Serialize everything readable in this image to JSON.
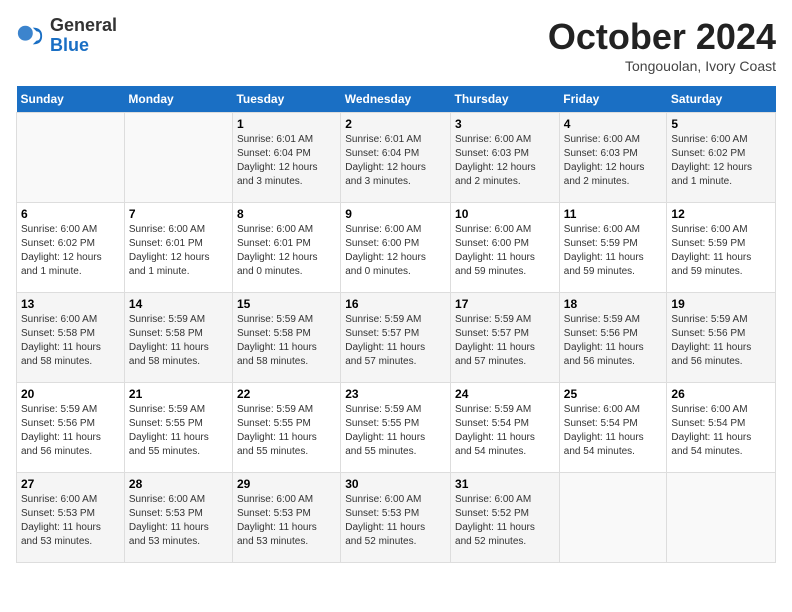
{
  "header": {
    "logo": {
      "general": "General",
      "blue": "Blue"
    },
    "title": "October 2024",
    "location": "Tongouolan, Ivory Coast"
  },
  "calendar": {
    "days_of_week": [
      "Sunday",
      "Monday",
      "Tuesday",
      "Wednesday",
      "Thursday",
      "Friday",
      "Saturday"
    ],
    "weeks": [
      [
        {
          "day": "",
          "info": ""
        },
        {
          "day": "",
          "info": ""
        },
        {
          "day": "1",
          "info": "Sunrise: 6:01 AM\nSunset: 6:04 PM\nDaylight: 12 hours\nand 3 minutes."
        },
        {
          "day": "2",
          "info": "Sunrise: 6:01 AM\nSunset: 6:04 PM\nDaylight: 12 hours\nand 3 minutes."
        },
        {
          "day": "3",
          "info": "Sunrise: 6:00 AM\nSunset: 6:03 PM\nDaylight: 12 hours\nand 2 minutes."
        },
        {
          "day": "4",
          "info": "Sunrise: 6:00 AM\nSunset: 6:03 PM\nDaylight: 12 hours\nand 2 minutes."
        },
        {
          "day": "5",
          "info": "Sunrise: 6:00 AM\nSunset: 6:02 PM\nDaylight: 12 hours\nand 1 minute."
        }
      ],
      [
        {
          "day": "6",
          "info": "Sunrise: 6:00 AM\nSunset: 6:02 PM\nDaylight: 12 hours\nand 1 minute."
        },
        {
          "day": "7",
          "info": "Sunrise: 6:00 AM\nSunset: 6:01 PM\nDaylight: 12 hours\nand 1 minute."
        },
        {
          "day": "8",
          "info": "Sunrise: 6:00 AM\nSunset: 6:01 PM\nDaylight: 12 hours\nand 0 minutes."
        },
        {
          "day": "9",
          "info": "Sunrise: 6:00 AM\nSunset: 6:00 PM\nDaylight: 12 hours\nand 0 minutes."
        },
        {
          "day": "10",
          "info": "Sunrise: 6:00 AM\nSunset: 6:00 PM\nDaylight: 11 hours\nand 59 minutes."
        },
        {
          "day": "11",
          "info": "Sunrise: 6:00 AM\nSunset: 5:59 PM\nDaylight: 11 hours\nand 59 minutes."
        },
        {
          "day": "12",
          "info": "Sunrise: 6:00 AM\nSunset: 5:59 PM\nDaylight: 11 hours\nand 59 minutes."
        }
      ],
      [
        {
          "day": "13",
          "info": "Sunrise: 6:00 AM\nSunset: 5:58 PM\nDaylight: 11 hours\nand 58 minutes."
        },
        {
          "day": "14",
          "info": "Sunrise: 5:59 AM\nSunset: 5:58 PM\nDaylight: 11 hours\nand 58 minutes."
        },
        {
          "day": "15",
          "info": "Sunrise: 5:59 AM\nSunset: 5:58 PM\nDaylight: 11 hours\nand 58 minutes."
        },
        {
          "day": "16",
          "info": "Sunrise: 5:59 AM\nSunset: 5:57 PM\nDaylight: 11 hours\nand 57 minutes."
        },
        {
          "day": "17",
          "info": "Sunrise: 5:59 AM\nSunset: 5:57 PM\nDaylight: 11 hours\nand 57 minutes."
        },
        {
          "day": "18",
          "info": "Sunrise: 5:59 AM\nSunset: 5:56 PM\nDaylight: 11 hours\nand 56 minutes."
        },
        {
          "day": "19",
          "info": "Sunrise: 5:59 AM\nSunset: 5:56 PM\nDaylight: 11 hours\nand 56 minutes."
        }
      ],
      [
        {
          "day": "20",
          "info": "Sunrise: 5:59 AM\nSunset: 5:56 PM\nDaylight: 11 hours\nand 56 minutes."
        },
        {
          "day": "21",
          "info": "Sunrise: 5:59 AM\nSunset: 5:55 PM\nDaylight: 11 hours\nand 55 minutes."
        },
        {
          "day": "22",
          "info": "Sunrise: 5:59 AM\nSunset: 5:55 PM\nDaylight: 11 hours\nand 55 minutes."
        },
        {
          "day": "23",
          "info": "Sunrise: 5:59 AM\nSunset: 5:55 PM\nDaylight: 11 hours\nand 55 minutes."
        },
        {
          "day": "24",
          "info": "Sunrise: 5:59 AM\nSunset: 5:54 PM\nDaylight: 11 hours\nand 54 minutes."
        },
        {
          "day": "25",
          "info": "Sunrise: 6:00 AM\nSunset: 5:54 PM\nDaylight: 11 hours\nand 54 minutes."
        },
        {
          "day": "26",
          "info": "Sunrise: 6:00 AM\nSunset: 5:54 PM\nDaylight: 11 hours\nand 54 minutes."
        }
      ],
      [
        {
          "day": "27",
          "info": "Sunrise: 6:00 AM\nSunset: 5:53 PM\nDaylight: 11 hours\nand 53 minutes."
        },
        {
          "day": "28",
          "info": "Sunrise: 6:00 AM\nSunset: 5:53 PM\nDaylight: 11 hours\nand 53 minutes."
        },
        {
          "day": "29",
          "info": "Sunrise: 6:00 AM\nSunset: 5:53 PM\nDaylight: 11 hours\nand 53 minutes."
        },
        {
          "day": "30",
          "info": "Sunrise: 6:00 AM\nSunset: 5:53 PM\nDaylight: 11 hours\nand 52 minutes."
        },
        {
          "day": "31",
          "info": "Sunrise: 6:00 AM\nSunset: 5:52 PM\nDaylight: 11 hours\nand 52 minutes."
        },
        {
          "day": "",
          "info": ""
        },
        {
          "day": "",
          "info": ""
        }
      ]
    ]
  }
}
